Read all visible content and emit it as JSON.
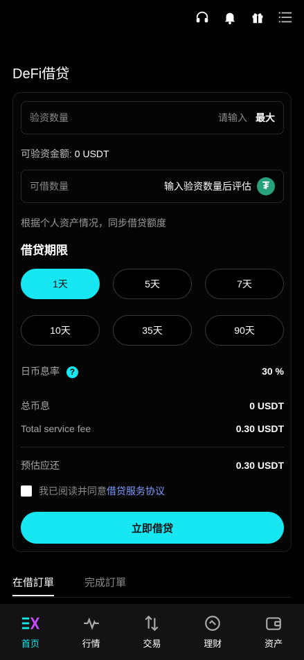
{
  "header": {
    "icons": [
      "headset-icon",
      "bell-icon",
      "gift-icon",
      "menu-icon"
    ]
  },
  "page": {
    "title": "DeFi借贷"
  },
  "form": {
    "invest_label": "验资数量",
    "invest_placeholder": "请输入",
    "max_label": "最大",
    "available_label": "可验资金额:",
    "available_value": "0 USDT",
    "borrow_label": "可借数量",
    "borrow_hint": "输入验资数量后评估",
    "note": "根据个人资产情况，同步借贷额度"
  },
  "periods": {
    "title": "借贷期限",
    "options": [
      "1天",
      "5天",
      "7天",
      "10天",
      "35天",
      "90天"
    ],
    "selected": "1天"
  },
  "summary": {
    "daily_rate_label": "日币息率",
    "daily_rate_value": "30 %",
    "total_interest_label": "总币息",
    "total_interest_value": "0 USDT",
    "service_fee_label": "Total service fee",
    "service_fee_value": "0.30 USDT",
    "expected_repay_label": "预估应还",
    "expected_repay_value": "0.30 USDT"
  },
  "agreement": {
    "text": "我已阅读并同意",
    "link": "借贷服务协议"
  },
  "cta_label": "立即借贷",
  "order_tabs": [
    "在借訂單",
    "完成訂單"
  ],
  "bottom_nav": [
    {
      "label": "首页",
      "icon": "home-logo-icon",
      "active": true
    },
    {
      "label": "行情",
      "icon": "pulse-icon"
    },
    {
      "label": "交易",
      "icon": "swap-icon"
    },
    {
      "label": "理财",
      "icon": "finance-icon"
    },
    {
      "label": "资产",
      "icon": "wallet-icon"
    }
  ],
  "colors": {
    "accent": "#17e7f2",
    "link": "#7f9cff",
    "tether": "#26a17b"
  }
}
